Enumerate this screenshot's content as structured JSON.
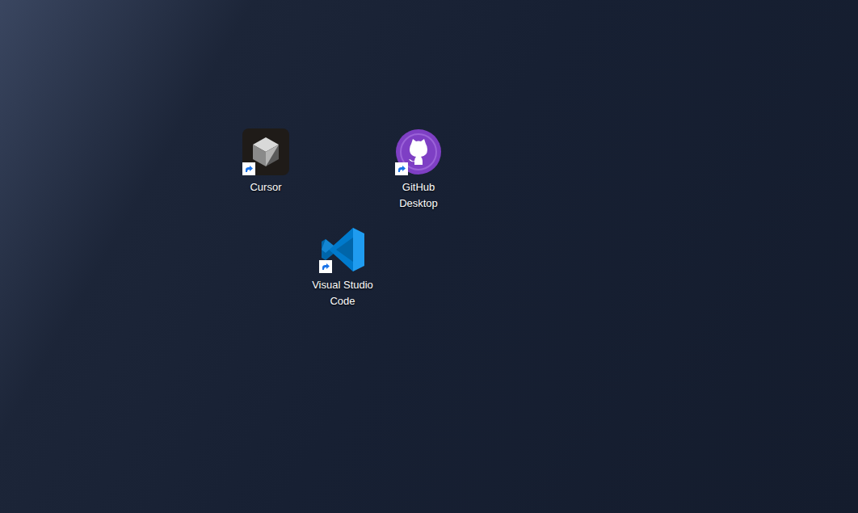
{
  "desktop": {
    "icons": [
      {
        "label": "Cursor",
        "kind": "cursor",
        "shortcut": true,
        "selected": false
      },
      {
        "label": "GitHub Desktop",
        "kind": "github",
        "shortcut": true,
        "selected": false
      },
      {
        "label": "Visual Studio Code",
        "kind": "vscode",
        "shortcut": true,
        "selected": false
      }
    ]
  }
}
